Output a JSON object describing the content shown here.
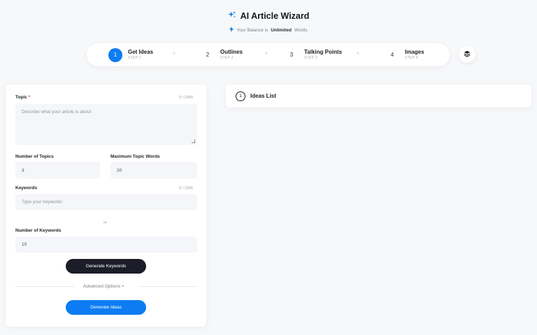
{
  "header": {
    "title": "AI Article Wizard",
    "balance_prefix": "Your Balance is",
    "balance_value": "Unlimited",
    "balance_suffix": "Words"
  },
  "steps": [
    {
      "num": "1",
      "title": "Get Ideas",
      "sub": "STEP 1",
      "active": true
    },
    {
      "num": "2",
      "title": "Outlines",
      "sub": "STEP 2",
      "active": false
    },
    {
      "num": "3",
      "title": "Talking Points",
      "sub": "STEP 3",
      "active": false
    },
    {
      "num": "4",
      "title": "Images",
      "sub": "STEP 4",
      "active": false
    }
  ],
  "step_separator": "»",
  "form": {
    "topic_label": "Topic",
    "topic_required": "*",
    "topic_counter": "0 / 2000",
    "topic_placeholder": "Describe what your article is about",
    "num_topics_label": "Number of Topics",
    "num_topics_value": "3",
    "max_words_label": "Maximum Topic Words",
    "max_words_value": "20",
    "keywords_label": "Keywords",
    "keywords_counter": "0 / 1000",
    "keywords_placeholder": "Type your keywords",
    "or_text": "or",
    "num_keywords_label": "Number of Keywords",
    "num_keywords_value": "10",
    "generate_keywords": "Generate Keywords",
    "advanced_options": "Advanced Options +",
    "generate_ideas": "Generate Ideas"
  },
  "ideas": {
    "num": "1",
    "title": "Ideas List"
  },
  "colors": {
    "accent": "#0d7cf2",
    "dark_button": "#1c1d28",
    "required": "#e03a3a"
  }
}
